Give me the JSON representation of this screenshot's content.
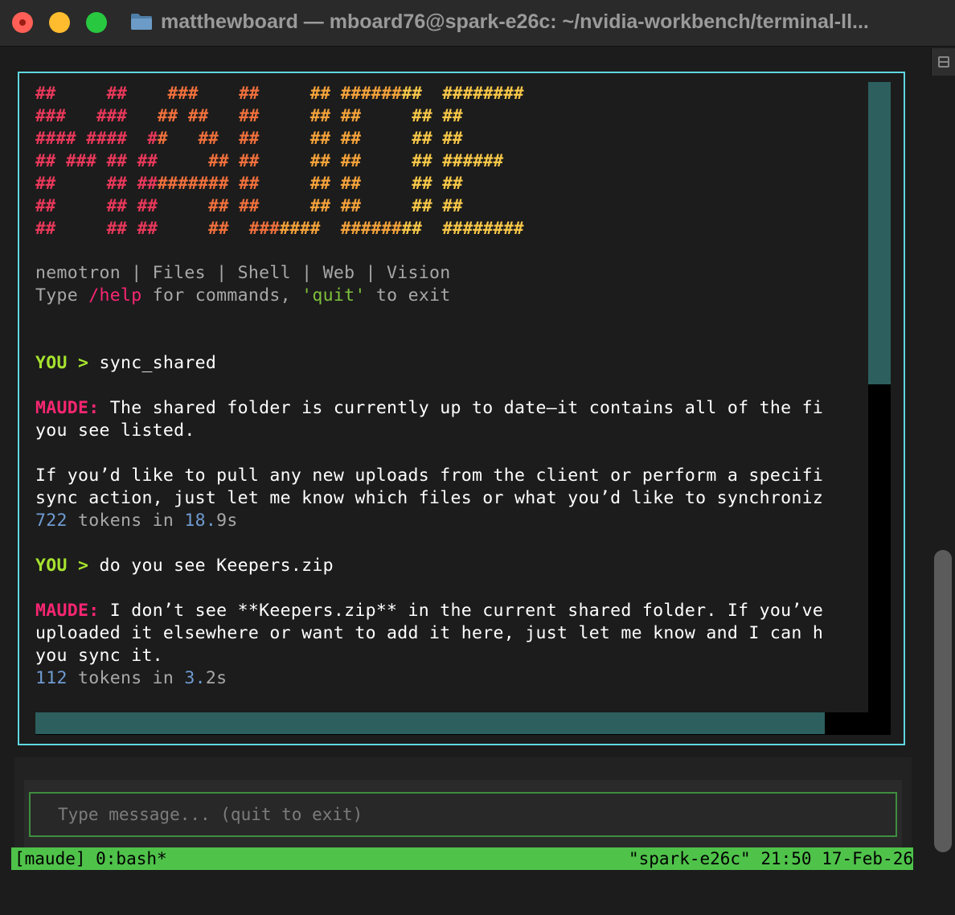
{
  "window": {
    "title": "matthewboard — mboard76@spark-e26c: ~/nvidia-workbench/terminal-ll..."
  },
  "logo": {
    "lines": [
      [
        [
          "##     ##    ###    ##     ## ########  ########",
          "#e8385a"
        ]
      ],
      [
        [
          "###   ###   ## ##   ##     ## ##     ## ##",
          "#e8385a"
        ]
      ],
      [
        [
          "#### ####  ##   ##  ##     ## ##     ## ##",
          "#e8385a"
        ]
      ],
      [
        [
          "## ### ## ##     ## ##     ## ##     ## ######",
          "#e8385a"
        ]
      ],
      [
        [
          "##     ## ######### ##     ## ##     ## ##",
          "#e8385a"
        ]
      ],
      [
        [
          "##     ## ##     ## ##     ## ##     ## ##",
          "#e8385a"
        ]
      ],
      [
        [
          "##     ## ##     ##  #######  ########  ########",
          "#e8385a"
        ]
      ]
    ],
    "gradient": [
      "#e8385a",
      "#f0703c",
      "#f4a23a",
      "#f7c748"
    ]
  },
  "header": {
    "capabilities": "nemotron | Files | Shell | Web | Vision",
    "help_prefix": "Type ",
    "help_cmd": "/help",
    "help_mid": " for commands, ",
    "help_quit": "'quit'",
    "help_suffix": " to exit"
  },
  "conversation": {
    "turn1": {
      "you_label": "YOU > ",
      "you_text": "sync_shared",
      "maude_label": "MAUDE:",
      "maude_line1": " The shared folder is currently up to date—it contains all of the fi",
      "maude_line2": "you see listed.",
      "maude_line3": "If you’d like to pull any new uploads from the client or perform a specifi",
      "maude_line4": "sync action, just let me know which files or what you’d like to synchroniz",
      "stats_tokens": "722",
      "stats_mid": " tokens in ",
      "stats_time_int": "18.",
      "stats_time_rest": "9s"
    },
    "turn2": {
      "you_label": "YOU > ",
      "you_text": "do you see Keepers.zip",
      "maude_label": "MAUDE:",
      "maude_line1": " I don’t see **Keepers.zip** in the current shared folder. If you’ve",
      "maude_line2": "uploaded it elsewhere or want to add it here, just let me know and I can h",
      "maude_line3": "you sync it.",
      "stats_tokens": "112",
      "stats_mid": " tokens in ",
      "stats_time_int": "3.",
      "stats_time_rest": "2s"
    }
  },
  "input": {
    "placeholder": "Type message... (quit to exit)",
    "value": ""
  },
  "statusbar": {
    "left": "[maude] 0:bash*",
    "right": "\"spark-e26c\" 21:50 17-Feb-26"
  },
  "colors": {
    "accent_border": "#5fd7e0",
    "you": "#a6e22e",
    "maude": "#f92672",
    "status_bg": "#4fc24a",
    "scroll_thumb": "#2d5f5f"
  },
  "icons": {
    "folder": "folder-icon",
    "split": "split-pane-icon"
  }
}
